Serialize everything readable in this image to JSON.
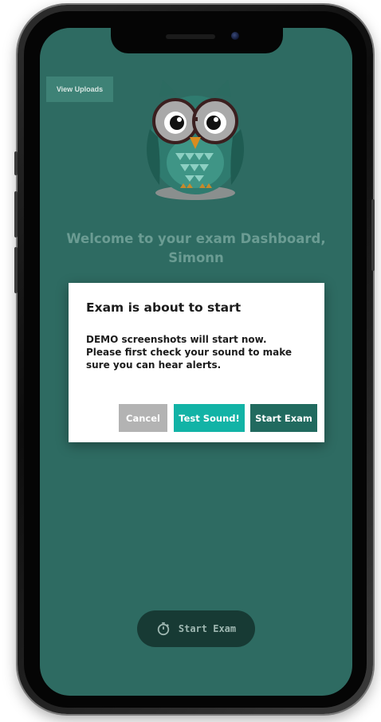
{
  "header": {
    "view_uploads_label": "View Uploads"
  },
  "welcome": {
    "line1": "Welcome to your exam Dashboard,",
    "line2": "Simonn"
  },
  "dialog": {
    "title": "Exam is about to start",
    "body_line1": "DEMO screenshots will start now.",
    "body_line2": "Please first check your sound to make",
    "body_line3": "sure you can hear alerts.",
    "cancel_label": "Cancel",
    "test_sound_label": "Test Sound!",
    "start_exam_label": "Start Exam"
  },
  "footer": {
    "start_exam_label": "Start Exam",
    "icon": "stopwatch-icon"
  },
  "colors": {
    "screen_bg": "#2e6b62",
    "test_sound": "#12b3a6",
    "start_exam": "#216a5f",
    "cancel": "#b3b3b3"
  }
}
